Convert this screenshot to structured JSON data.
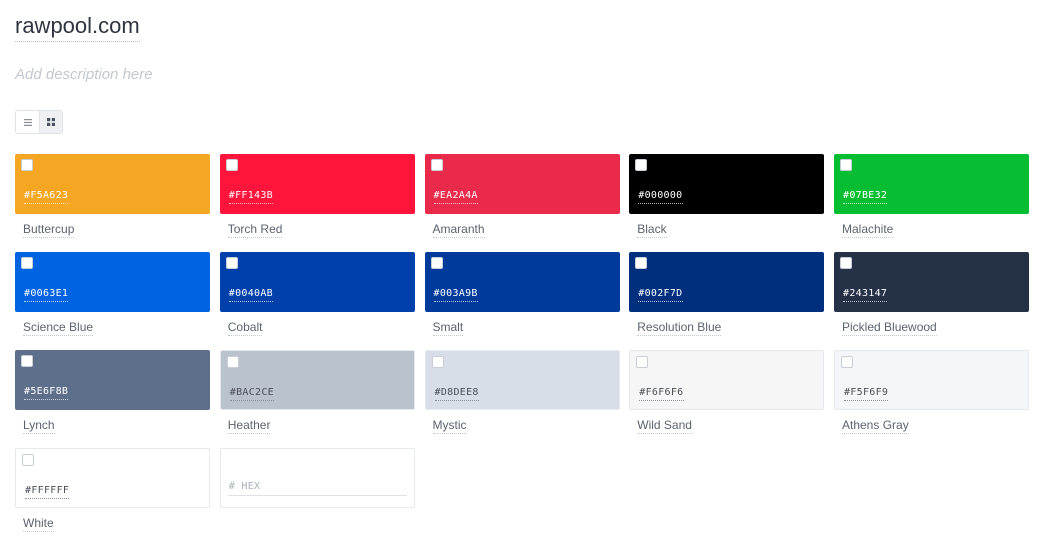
{
  "palette": {
    "title": "rawpool.com",
    "description_placeholder": "Add description here"
  },
  "view_toggle": {
    "list_icon": "list-icon",
    "grid_icon": "grid-icon",
    "active": "grid"
  },
  "colors": [
    {
      "hex": "#F5A623",
      "name": "Buttercup",
      "text": "light"
    },
    {
      "hex": "#FF143B",
      "name": "Torch Red",
      "text": "light"
    },
    {
      "hex": "#EA2A4A",
      "name": "Amaranth",
      "text": "light"
    },
    {
      "hex": "#000000",
      "name": "Black",
      "text": "light"
    },
    {
      "hex": "#07BE32",
      "name": "Malachite",
      "text": "light"
    },
    {
      "hex": "#0063E1",
      "name": "Science Blue",
      "text": "light"
    },
    {
      "hex": "#0040AB",
      "name": "Cobalt",
      "text": "light"
    },
    {
      "hex": "#003A9B",
      "name": "Smalt",
      "text": "light"
    },
    {
      "hex": "#002F7D",
      "name": "Resolution Blue",
      "text": "light"
    },
    {
      "hex": "#243147",
      "name": "Pickled Bluewood",
      "text": "light"
    },
    {
      "hex": "#5E6F8B",
      "name": "Lynch",
      "text": "light"
    },
    {
      "hex": "#BAC2CE",
      "name": "Heather",
      "text": "dark"
    },
    {
      "hex": "#D8DEE8",
      "name": "Mystic",
      "text": "dark"
    },
    {
      "hex": "#F6F6F6",
      "name": "Wild Sand",
      "text": "dark"
    },
    {
      "hex": "#F5F6F9",
      "name": "Athens Gray",
      "text": "dark"
    },
    {
      "hex": "#FFFFFF",
      "name": "White",
      "text": "dark"
    }
  ],
  "add_color": {
    "placeholder": "# HEX",
    "value": ""
  }
}
